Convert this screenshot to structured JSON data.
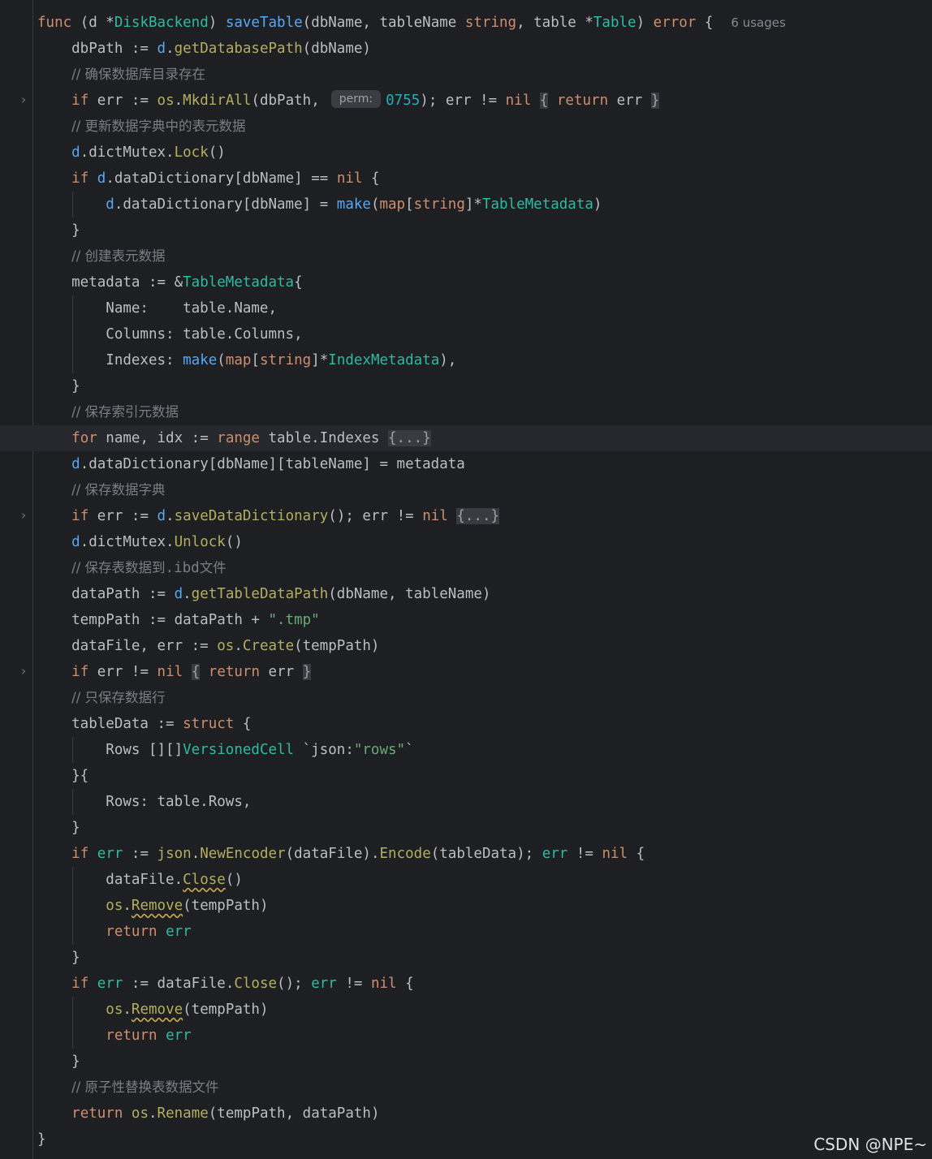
{
  "editor": {
    "usages_hint": "6 usages",
    "perm_hint": "perm:",
    "folded_placeholder": "{...}",
    "watermark": "CSDN @NPE~"
  },
  "comments": {
    "c1": "// 确保数据库目录存在",
    "c2": "// 更新数据字典中的表元数据",
    "c3": "// 创建表元数据",
    "c4": "// 保存索引元数据",
    "c5": "// 保存数据字典",
    "c6": "// 保存表数据到",
    "c6_file": ".ibd",
    "c6_tail": "文件",
    "c7": "// 只保存数据行",
    "c8": "// 原子性替换表数据文件"
  },
  "strings": {
    "tmp": "\".tmp\"",
    "json_tag_open": "`json:",
    "json_tag_val": "\"rows\"",
    "json_tag_close": "`"
  },
  "numbers": {
    "perm": "0755"
  }
}
